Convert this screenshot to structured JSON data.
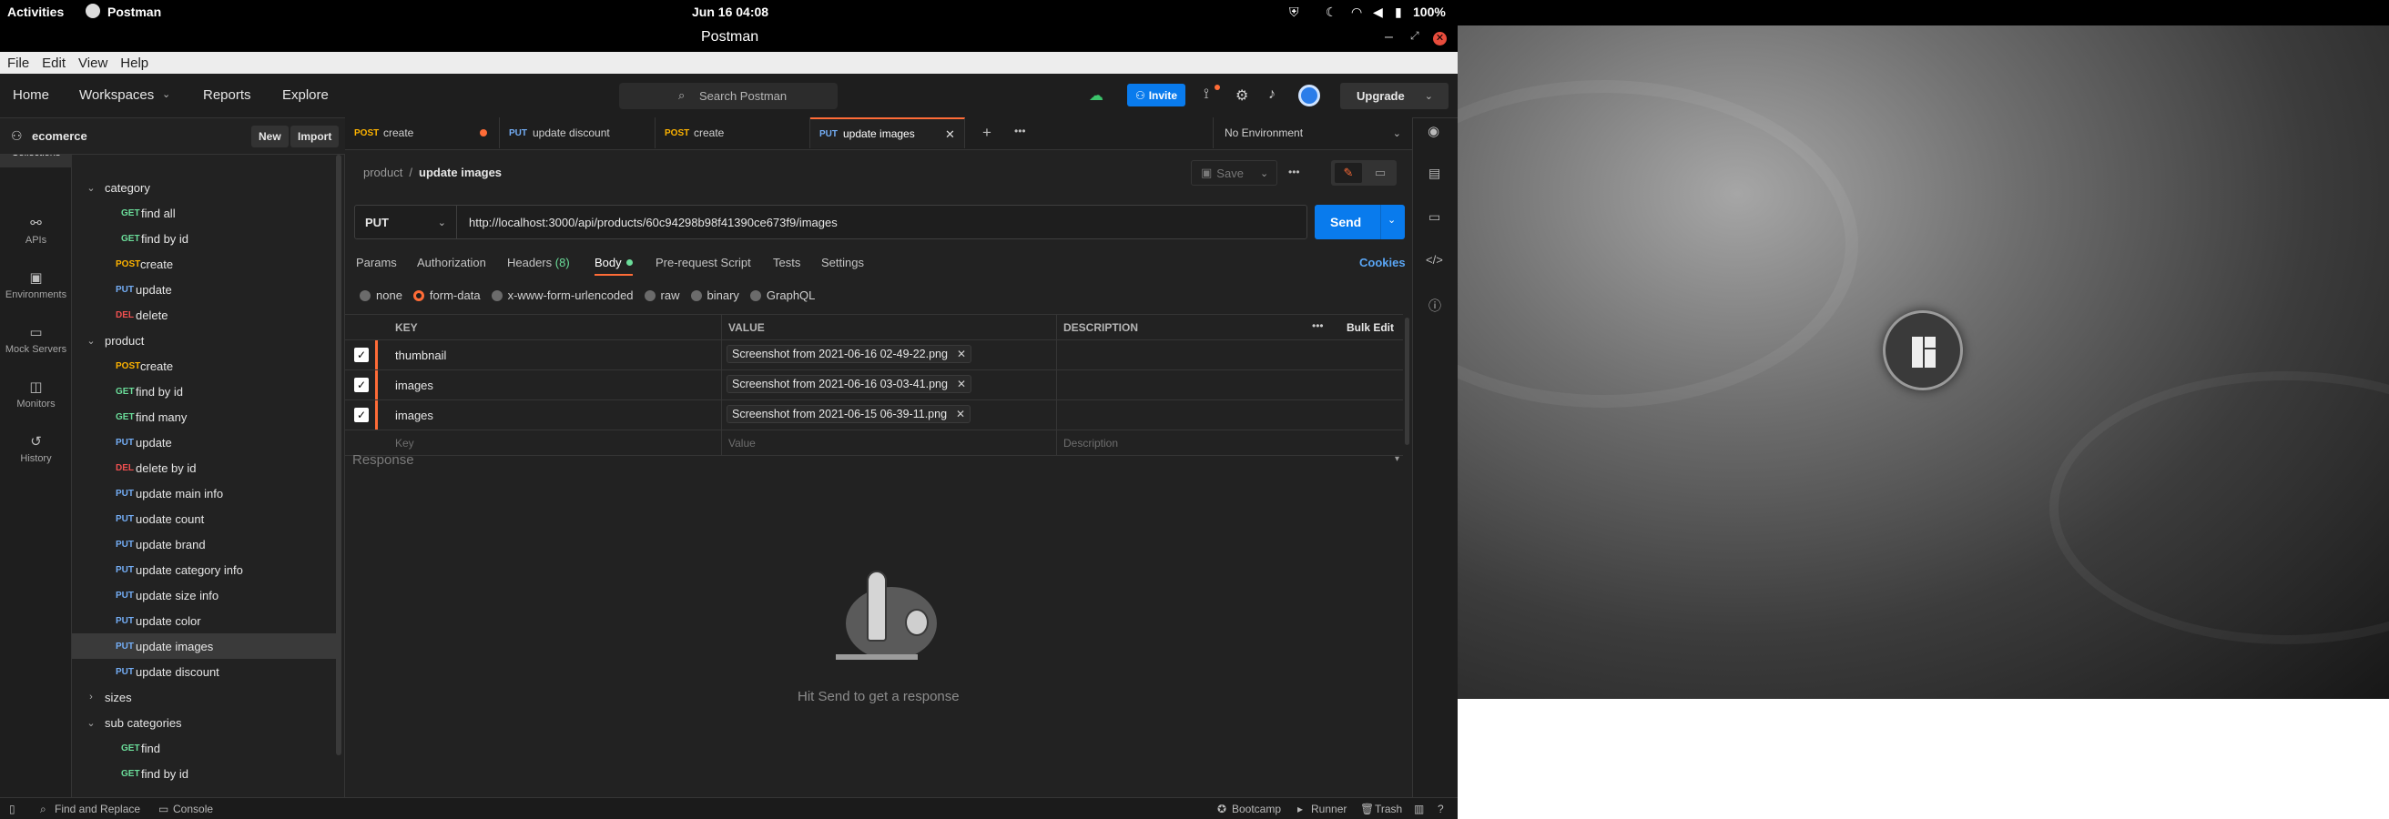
{
  "system_bar": {
    "activities": "Activities",
    "app_name": "Postman",
    "clock": "Jun 16 04:08",
    "battery": "100%"
  },
  "window": {
    "title": "Postman"
  },
  "menu": [
    "File",
    "Edit",
    "View",
    "Help"
  ],
  "header": {
    "home": "Home",
    "workspaces": "Workspaces",
    "reports": "Reports",
    "explore": "Explore",
    "search_placeholder": "Search Postman",
    "invite": "Invite",
    "upgrade": "Upgrade"
  },
  "sidebar": {
    "workspace_name": "ecomerce",
    "new_label": "New",
    "import_label": "Import",
    "nav": [
      {
        "label": "Collections",
        "icon": "collections-icon"
      },
      {
        "label": "APIs",
        "icon": "apis-icon"
      },
      {
        "label": "Environments",
        "icon": "environments-icon"
      },
      {
        "label": "Mock Servers",
        "icon": "mock-servers-icon"
      },
      {
        "label": "Monitors",
        "icon": "monitors-icon"
      },
      {
        "label": "History",
        "icon": "history-icon"
      }
    ],
    "tree": [
      {
        "type": "folder",
        "label": "category",
        "expanded": true
      },
      {
        "type": "request",
        "method": "GET",
        "label": "find all"
      },
      {
        "type": "request",
        "method": "GET",
        "label": "find by id"
      },
      {
        "type": "request",
        "method": "POST",
        "label": "create"
      },
      {
        "type": "request",
        "method": "PUT",
        "label": "update"
      },
      {
        "type": "request",
        "method": "DEL",
        "label": "delete"
      },
      {
        "type": "folder",
        "label": "product",
        "expanded": true
      },
      {
        "type": "request",
        "method": "POST",
        "label": "create"
      },
      {
        "type": "request",
        "method": "GET",
        "label": "find by id"
      },
      {
        "type": "request",
        "method": "GET",
        "label": "find many"
      },
      {
        "type": "request",
        "method": "PUT",
        "label": "update"
      },
      {
        "type": "request",
        "method": "DEL",
        "label": "delete by id"
      },
      {
        "type": "request",
        "method": "PUT",
        "label": "update main info"
      },
      {
        "type": "request",
        "method": "PUT",
        "label": "uodate count"
      },
      {
        "type": "request",
        "method": "PUT",
        "label": "update brand"
      },
      {
        "type": "request",
        "method": "PUT",
        "label": "update category info"
      },
      {
        "type": "request",
        "method": "PUT",
        "label": "update size info"
      },
      {
        "type": "request",
        "method": "PUT",
        "label": "update color"
      },
      {
        "type": "request",
        "method": "PUT",
        "label": "update images",
        "selected": true
      },
      {
        "type": "request",
        "method": "PUT",
        "label": "update discount"
      },
      {
        "type": "folder",
        "label": "sizes",
        "expanded": false
      },
      {
        "type": "folder",
        "label": "sub categories",
        "expanded": true
      },
      {
        "type": "request",
        "method": "GET",
        "label": "find"
      },
      {
        "type": "request",
        "method": "GET",
        "label": "find by id"
      }
    ]
  },
  "tabs": [
    {
      "method": "POST",
      "label": "create",
      "unsaved": true
    },
    {
      "method": "PUT",
      "label": "update discount"
    },
    {
      "method": "POST",
      "label": "create"
    },
    {
      "method": "PUT",
      "label": "update images",
      "active": true
    }
  ],
  "environment": "No Environment",
  "request": {
    "breadcrumb_parent": "product",
    "breadcrumb_sep": "/",
    "breadcrumb_name": "update images",
    "save_label": "Save",
    "method": "PUT",
    "url": "http://localhost:3000/api/products/60c94298b98f41390ce673f9/images",
    "send_label": "Send",
    "subtabs": {
      "params": "Params",
      "authorization": "Authorization",
      "headers": "Headers",
      "headers_count": "(8)",
      "body": "Body",
      "pre_request": "Pre-request Script",
      "tests": "Tests",
      "settings": "Settings"
    },
    "cookies": "Cookies",
    "body_modes": [
      "none",
      "form-data",
      "x-www-form-urlencoded",
      "raw",
      "binary",
      "GraphQL"
    ],
    "table": {
      "headers": {
        "key": "KEY",
        "value": "VALUE",
        "description": "DESCRIPTION",
        "bulk_edit": "Bulk Edit"
      },
      "rows": [
        {
          "key": "thumbnail",
          "value": "Screenshot from 2021-06-16 02-49-22.png",
          "checked": true
        },
        {
          "key": "images",
          "value": "Screenshot from 2021-06-16 03-03-41.png",
          "checked": true
        },
        {
          "key": "images",
          "value": "Screenshot from 2021-06-15 06-39-11.png",
          "checked": true
        }
      ],
      "placeholder": {
        "key": "Key",
        "value": "Value",
        "description": "Description"
      }
    }
  },
  "response": {
    "title": "Response",
    "hint": "Hit Send to get a response"
  },
  "statusbar": {
    "find_replace": "Find and Replace",
    "console": "Console",
    "bootcamp": "Bootcamp",
    "runner": "Runner",
    "trash": "Trash"
  },
  "colors": {
    "accent": "#ff6c37",
    "primary": "#097bed",
    "get": "#6bdd9a",
    "post": "#ffb400",
    "put": "#74aef6",
    "delete": "#f05050"
  }
}
